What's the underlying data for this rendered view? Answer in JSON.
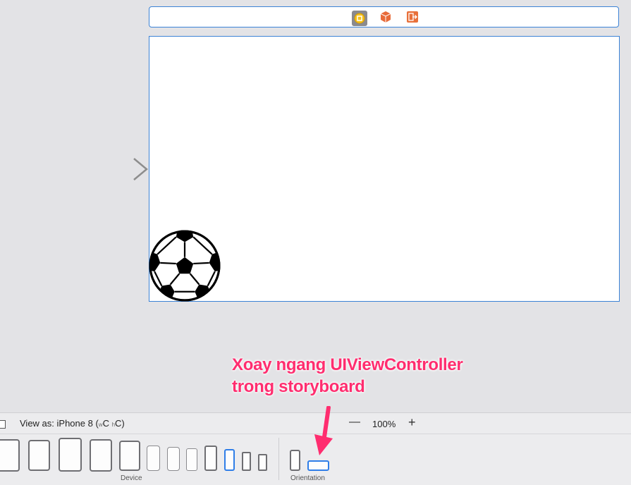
{
  "scene_dock": {
    "icons": [
      "view-controller-icon",
      "first-responder-icon",
      "exit-icon"
    ]
  },
  "annotation": {
    "line1": "Xoay ngang UIViewController",
    "line2": "trong storyboard",
    "color": "#ff2d6f"
  },
  "bottom_bar": {
    "view_as_prefix": "View as: iPhone 8 (",
    "w_label": "w",
    "w_value": "C",
    "h_label": "h",
    "h_value": "C)",
    "zoom_minus": "—",
    "zoom_value": "100%",
    "zoom_plus": "+",
    "device_label": "Device",
    "orientation_label": "Orientation"
  },
  "colors": {
    "selection_blue": "#3b82d6",
    "canvas_bg": "#e3e3e6",
    "accent_orange": "#e0703a"
  }
}
